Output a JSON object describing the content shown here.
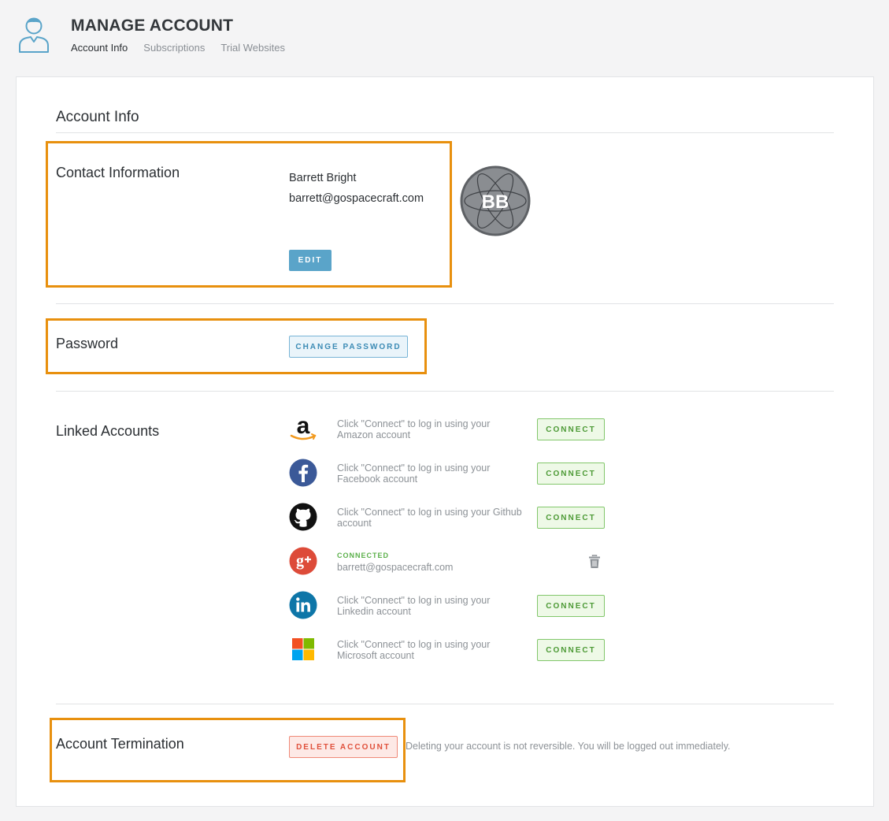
{
  "header": {
    "title": "MANAGE ACCOUNT",
    "tabs": [
      {
        "label": "Account Info"
      },
      {
        "label": "Subscriptions"
      },
      {
        "label": "Trial Websites"
      }
    ]
  },
  "main": {
    "section_title": "Account Info",
    "contact": {
      "heading": "Contact Information",
      "name": "Barrett Bright",
      "email": "barrett@gospacecraft.com",
      "edit_label": "EDIT",
      "avatar_initials": "BB"
    },
    "password": {
      "heading": "Password",
      "button_label": "CHANGE PASSWORD"
    },
    "linked_accounts": {
      "heading": "Linked Accounts",
      "items": [
        {
          "provider": "amazon",
          "icon": "amazon-icon",
          "text": "Click \"Connect\" to log in using your Amazon account",
          "button_label": "CONNECT"
        },
        {
          "provider": "facebook",
          "icon": "facebook-icon",
          "text": "Click \"Connect\" to log in using your Facebook account",
          "button_label": "CONNECT"
        },
        {
          "provider": "github",
          "icon": "github-icon",
          "text": "Click \"Connect\" to log in using your Github account",
          "button_label": "CONNECT"
        },
        {
          "provider": "google-plus",
          "icon": "google-plus-icon",
          "status": "CONNECTED",
          "email": "barrett@gospacecraft.com",
          "action_icon": "trash-icon"
        },
        {
          "provider": "linkedin",
          "icon": "linkedin-icon",
          "text": "Click \"Connect\" to log in using your Linkedin account",
          "button_label": "CONNECT"
        },
        {
          "provider": "microsoft",
          "icon": "microsoft-icon",
          "text": "Click \"Connect\" to log in using your Microsoft account",
          "button_label": "CONNECT"
        }
      ]
    },
    "termination": {
      "heading": "Account Termination",
      "button_label": "DELETE ACCOUNT",
      "note": "Deleting your account is not reversible. You will be logged out immediately."
    }
  },
  "colors": {
    "highlight": "#e8900e",
    "edit_button": "#5aa4c9",
    "connect_green": "#4d9a36",
    "delete_red": "#e0513c"
  }
}
